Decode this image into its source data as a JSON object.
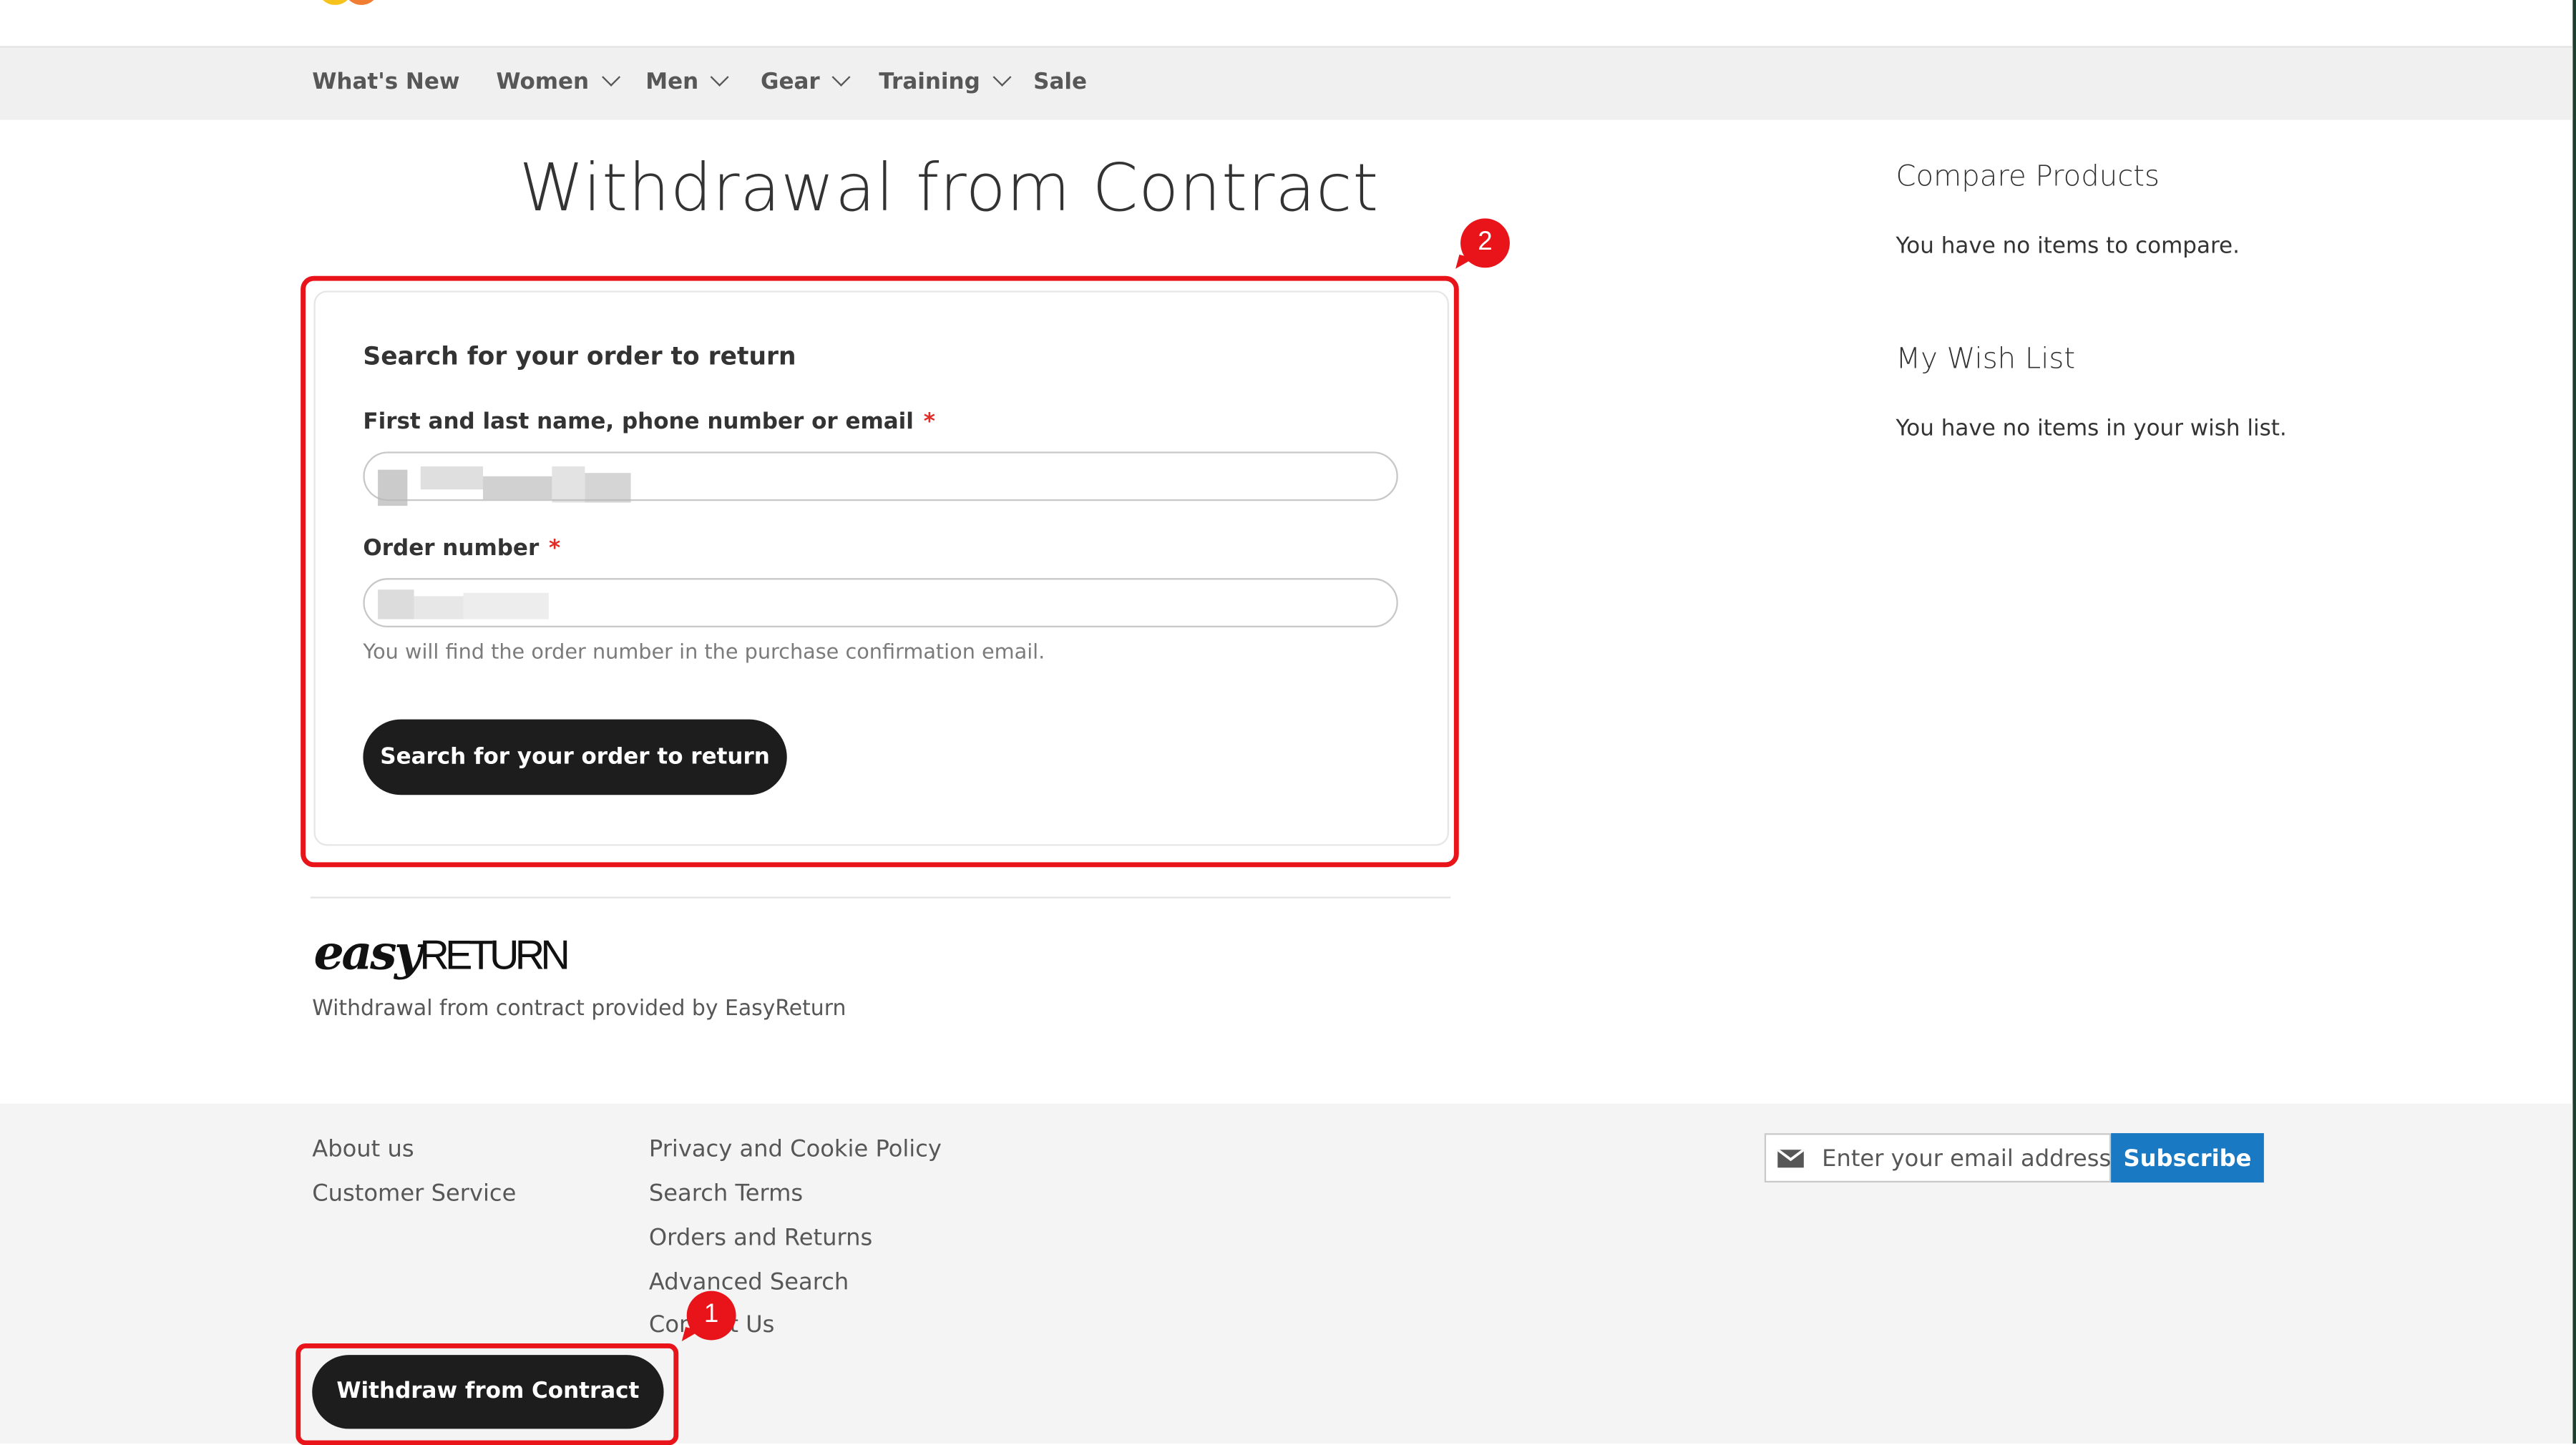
{
  "nav": {
    "items": [
      {
        "label": "What's New",
        "has_dropdown": false
      },
      {
        "label": "Women",
        "has_dropdown": true
      },
      {
        "label": "Men",
        "has_dropdown": true
      },
      {
        "label": "Gear",
        "has_dropdown": true
      },
      {
        "label": "Training",
        "has_dropdown": true
      },
      {
        "label": "Sale",
        "has_dropdown": false
      }
    ]
  },
  "page": {
    "title": "Withdrawal from Contract"
  },
  "form": {
    "heading": "Search for your order to return",
    "name_label": "First and last name, phone number or email",
    "order_label": "Order number",
    "required_mark": "*",
    "hint": "You will find the order number in the purchase confirmation email.",
    "submit_label": "Search for your order to return"
  },
  "easyreturn": {
    "logo_easy": "easy",
    "logo_return": "RETURN",
    "caption": "Withdrawal from contract provided by EasyReturn"
  },
  "sidebar": {
    "compare_title": "Compare Products",
    "compare_text": "You have no items to compare.",
    "wishlist_title": "My Wish List",
    "wishlist_text": "You have no items in your wish list."
  },
  "footer": {
    "col1": [
      "About us",
      "Customer Service"
    ],
    "col2": [
      "Privacy and Cookie Policy",
      "Search Terms",
      "Orders and Returns",
      "Advanced Search",
      "Contact Us"
    ],
    "newsletter_placeholder": "Enter your email address",
    "subscribe_label": "Subscribe",
    "withdraw_label": "Withdraw from Contract"
  },
  "annotations": {
    "marker_1": "1",
    "marker_2": "2"
  },
  "colors": {
    "highlight": "#e8141a",
    "subscribe": "#1979c3",
    "dark_button": "#1d1d1d"
  },
  "icons": [
    "chevron-down-icon",
    "mail-icon"
  ]
}
